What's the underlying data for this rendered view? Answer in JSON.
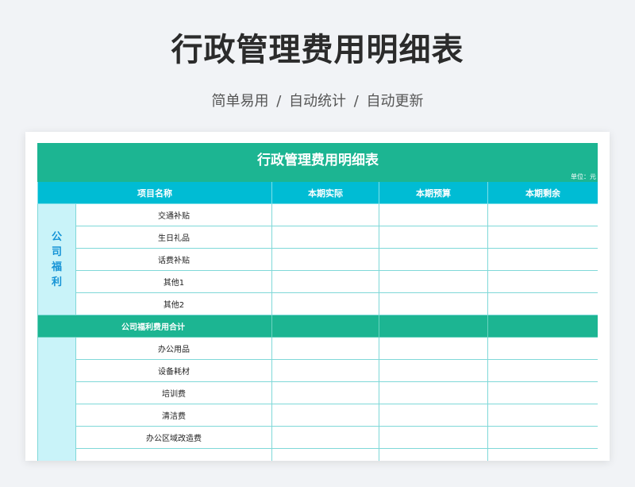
{
  "page": {
    "title": "行政管理费用明细表",
    "subtitle": "简单易用  /  自动统计  /  自动更新"
  },
  "sheet": {
    "title": "行政管理费用明细表",
    "unit": "单位：元",
    "columns": [
      "项目名称",
      "本期实际",
      "本期预算",
      "本期剩余"
    ],
    "groups": [
      {
        "category": "公司福利",
        "items": [
          "交通补贴",
          "生日礼品",
          "话费补贴",
          "其他1",
          "其他2"
        ],
        "subtotal_label": "公司福利费用合计"
      },
      {
        "category": "",
        "items": [
          "办公用品",
          "设备耗材",
          "培训费",
          "清洁费",
          "办公区域改造费",
          ""
        ]
      }
    ]
  },
  "colors": {
    "title_bg": "#1cb592",
    "header_bg": "#00bcd4",
    "category_bg": "#c9f3f9",
    "category_text": "#1593d6",
    "grid": "#7fd8d8"
  }
}
